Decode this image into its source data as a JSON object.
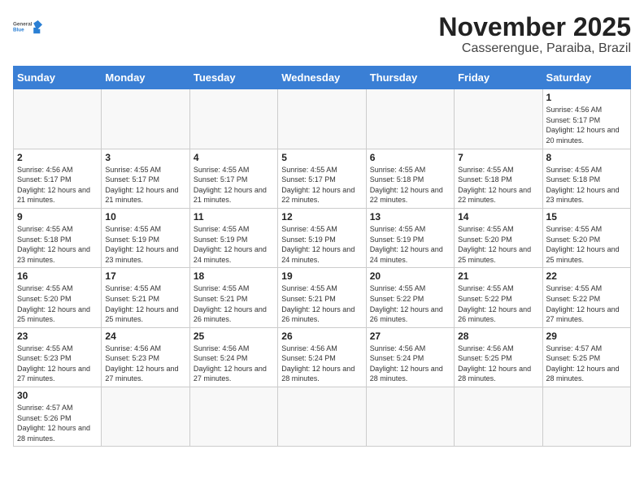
{
  "header": {
    "logo_general": "General",
    "logo_blue": "Blue",
    "month_title": "November 2025",
    "subtitle": "Casserengue, Paraiba, Brazil"
  },
  "weekdays": [
    "Sunday",
    "Monday",
    "Tuesday",
    "Wednesday",
    "Thursday",
    "Friday",
    "Saturday"
  ],
  "weeks": [
    [
      {
        "day": "",
        "sunrise": "",
        "sunset": "",
        "daylight": ""
      },
      {
        "day": "",
        "sunrise": "",
        "sunset": "",
        "daylight": ""
      },
      {
        "day": "",
        "sunrise": "",
        "sunset": "",
        "daylight": ""
      },
      {
        "day": "",
        "sunrise": "",
        "sunset": "",
        "daylight": ""
      },
      {
        "day": "",
        "sunrise": "",
        "sunset": "",
        "daylight": ""
      },
      {
        "day": "",
        "sunrise": "",
        "sunset": "",
        "daylight": ""
      },
      {
        "day": "1",
        "sunrise": "Sunrise: 4:56 AM",
        "sunset": "Sunset: 5:17 PM",
        "daylight": "Daylight: 12 hours and 20 minutes."
      }
    ],
    [
      {
        "day": "2",
        "sunrise": "Sunrise: 4:56 AM",
        "sunset": "Sunset: 5:17 PM",
        "daylight": "Daylight: 12 hours and 21 minutes."
      },
      {
        "day": "3",
        "sunrise": "Sunrise: 4:55 AM",
        "sunset": "Sunset: 5:17 PM",
        "daylight": "Daylight: 12 hours and 21 minutes."
      },
      {
        "day": "4",
        "sunrise": "Sunrise: 4:55 AM",
        "sunset": "Sunset: 5:17 PM",
        "daylight": "Daylight: 12 hours and 21 minutes."
      },
      {
        "day": "5",
        "sunrise": "Sunrise: 4:55 AM",
        "sunset": "Sunset: 5:17 PM",
        "daylight": "Daylight: 12 hours and 22 minutes."
      },
      {
        "day": "6",
        "sunrise": "Sunrise: 4:55 AM",
        "sunset": "Sunset: 5:18 PM",
        "daylight": "Daylight: 12 hours and 22 minutes."
      },
      {
        "day": "7",
        "sunrise": "Sunrise: 4:55 AM",
        "sunset": "Sunset: 5:18 PM",
        "daylight": "Daylight: 12 hours and 22 minutes."
      },
      {
        "day": "8",
        "sunrise": "Sunrise: 4:55 AM",
        "sunset": "Sunset: 5:18 PM",
        "daylight": "Daylight: 12 hours and 23 minutes."
      }
    ],
    [
      {
        "day": "9",
        "sunrise": "Sunrise: 4:55 AM",
        "sunset": "Sunset: 5:18 PM",
        "daylight": "Daylight: 12 hours and 23 minutes."
      },
      {
        "day": "10",
        "sunrise": "Sunrise: 4:55 AM",
        "sunset": "Sunset: 5:19 PM",
        "daylight": "Daylight: 12 hours and 23 minutes."
      },
      {
        "day": "11",
        "sunrise": "Sunrise: 4:55 AM",
        "sunset": "Sunset: 5:19 PM",
        "daylight": "Daylight: 12 hours and 24 minutes."
      },
      {
        "day": "12",
        "sunrise": "Sunrise: 4:55 AM",
        "sunset": "Sunset: 5:19 PM",
        "daylight": "Daylight: 12 hours and 24 minutes."
      },
      {
        "day": "13",
        "sunrise": "Sunrise: 4:55 AM",
        "sunset": "Sunset: 5:19 PM",
        "daylight": "Daylight: 12 hours and 24 minutes."
      },
      {
        "day": "14",
        "sunrise": "Sunrise: 4:55 AM",
        "sunset": "Sunset: 5:20 PM",
        "daylight": "Daylight: 12 hours and 25 minutes."
      },
      {
        "day": "15",
        "sunrise": "Sunrise: 4:55 AM",
        "sunset": "Sunset: 5:20 PM",
        "daylight": "Daylight: 12 hours and 25 minutes."
      }
    ],
    [
      {
        "day": "16",
        "sunrise": "Sunrise: 4:55 AM",
        "sunset": "Sunset: 5:20 PM",
        "daylight": "Daylight: 12 hours and 25 minutes."
      },
      {
        "day": "17",
        "sunrise": "Sunrise: 4:55 AM",
        "sunset": "Sunset: 5:21 PM",
        "daylight": "Daylight: 12 hours and 25 minutes."
      },
      {
        "day": "18",
        "sunrise": "Sunrise: 4:55 AM",
        "sunset": "Sunset: 5:21 PM",
        "daylight": "Daylight: 12 hours and 26 minutes."
      },
      {
        "day": "19",
        "sunrise": "Sunrise: 4:55 AM",
        "sunset": "Sunset: 5:21 PM",
        "daylight": "Daylight: 12 hours and 26 minutes."
      },
      {
        "day": "20",
        "sunrise": "Sunrise: 4:55 AM",
        "sunset": "Sunset: 5:22 PM",
        "daylight": "Daylight: 12 hours and 26 minutes."
      },
      {
        "day": "21",
        "sunrise": "Sunrise: 4:55 AM",
        "sunset": "Sunset: 5:22 PM",
        "daylight": "Daylight: 12 hours and 26 minutes."
      },
      {
        "day": "22",
        "sunrise": "Sunrise: 4:55 AM",
        "sunset": "Sunset: 5:22 PM",
        "daylight": "Daylight: 12 hours and 27 minutes."
      }
    ],
    [
      {
        "day": "23",
        "sunrise": "Sunrise: 4:55 AM",
        "sunset": "Sunset: 5:23 PM",
        "daylight": "Daylight: 12 hours and 27 minutes."
      },
      {
        "day": "24",
        "sunrise": "Sunrise: 4:56 AM",
        "sunset": "Sunset: 5:23 PM",
        "daylight": "Daylight: 12 hours and 27 minutes."
      },
      {
        "day": "25",
        "sunrise": "Sunrise: 4:56 AM",
        "sunset": "Sunset: 5:24 PM",
        "daylight": "Daylight: 12 hours and 27 minutes."
      },
      {
        "day": "26",
        "sunrise": "Sunrise: 4:56 AM",
        "sunset": "Sunset: 5:24 PM",
        "daylight": "Daylight: 12 hours and 28 minutes."
      },
      {
        "day": "27",
        "sunrise": "Sunrise: 4:56 AM",
        "sunset": "Sunset: 5:24 PM",
        "daylight": "Daylight: 12 hours and 28 minutes."
      },
      {
        "day": "28",
        "sunrise": "Sunrise: 4:56 AM",
        "sunset": "Sunset: 5:25 PM",
        "daylight": "Daylight: 12 hours and 28 minutes."
      },
      {
        "day": "29",
        "sunrise": "Sunrise: 4:57 AM",
        "sunset": "Sunset: 5:25 PM",
        "daylight": "Daylight: 12 hours and 28 minutes."
      }
    ],
    [
      {
        "day": "30",
        "sunrise": "Sunrise: 4:57 AM",
        "sunset": "Sunset: 5:26 PM",
        "daylight": "Daylight: 12 hours and 28 minutes."
      },
      {
        "day": "",
        "sunrise": "",
        "sunset": "",
        "daylight": ""
      },
      {
        "day": "",
        "sunrise": "",
        "sunset": "",
        "daylight": ""
      },
      {
        "day": "",
        "sunrise": "",
        "sunset": "",
        "daylight": ""
      },
      {
        "day": "",
        "sunrise": "",
        "sunset": "",
        "daylight": ""
      },
      {
        "day": "",
        "sunrise": "",
        "sunset": "",
        "daylight": ""
      },
      {
        "day": "",
        "sunrise": "",
        "sunset": "",
        "daylight": ""
      }
    ]
  ]
}
